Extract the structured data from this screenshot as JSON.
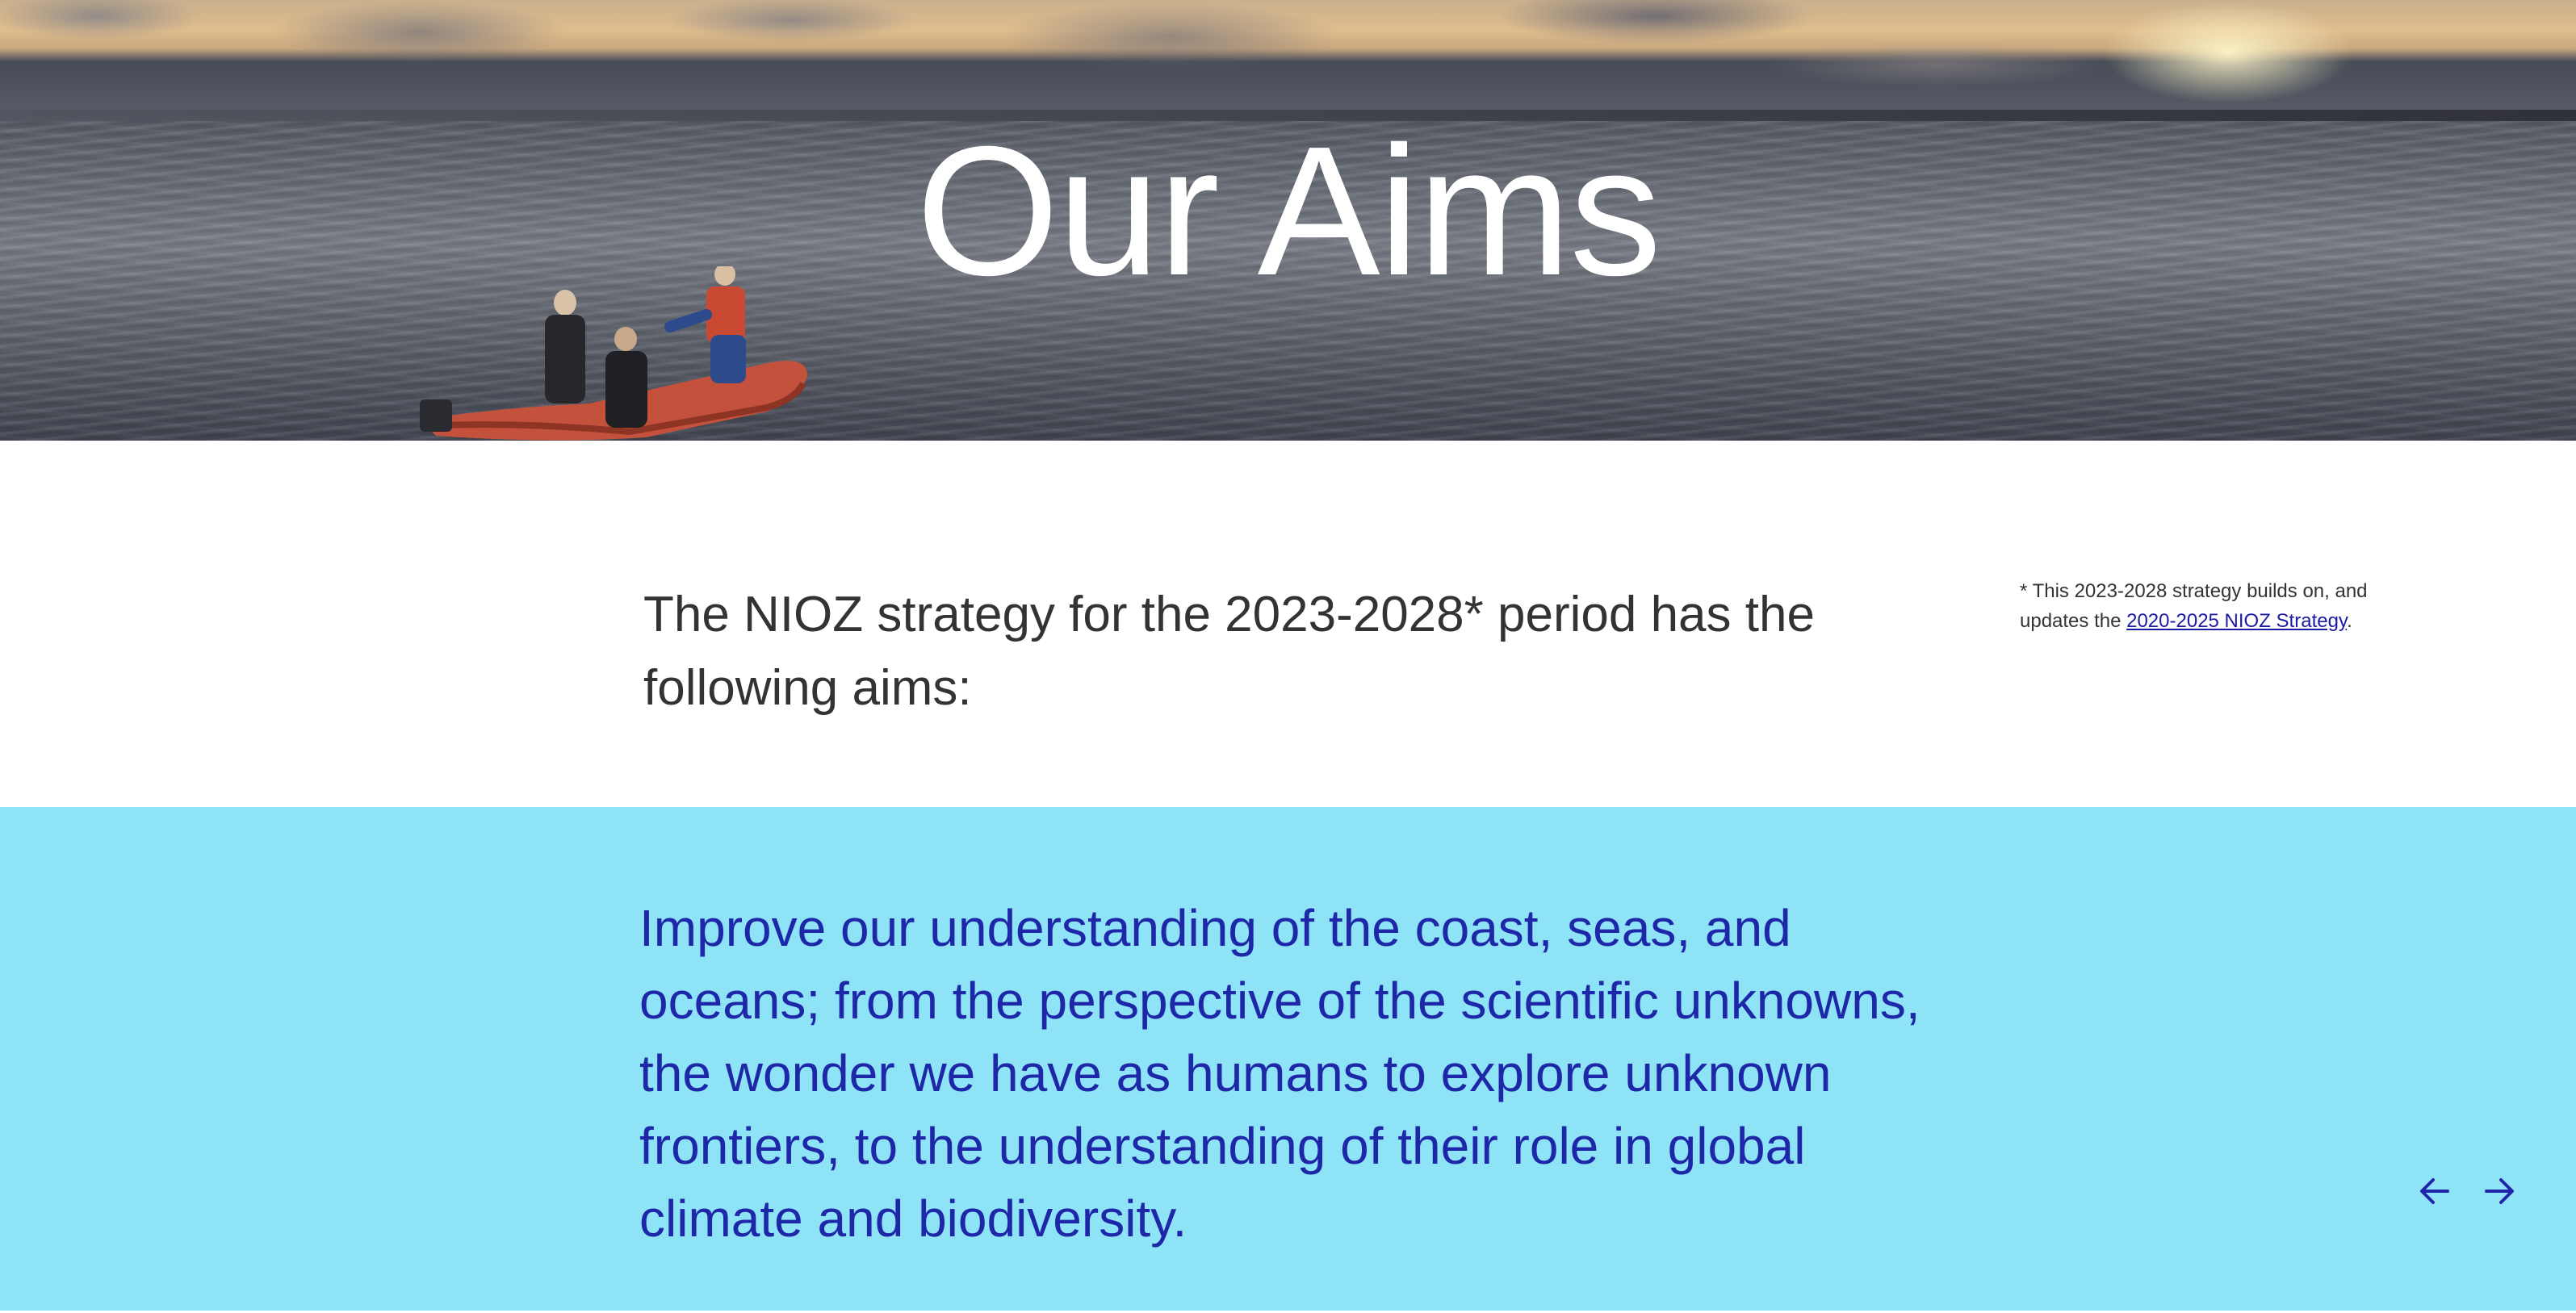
{
  "hero": {
    "title": "Our Aims",
    "image_icon": "boat-at-sea-image"
  },
  "intro": {
    "text": "The NIOZ strategy for the 2023-2028* period has the following aims:",
    "footnote_prefix": "* This 2023-2028 strategy builds on, and updates the ",
    "footnote_link_label": "2020-2025 NIOZ Strategy",
    "footnote_suffix": "."
  },
  "aims": {
    "current_aim": "Improve our understanding of the coast, seas, and oceans; from the perspective of the scientific unknowns, the wonder we have as humans to explore unknown frontiers, to the understanding of their role in global climate and biodiversity.",
    "prev_icon": "arrow-left-icon",
    "next_icon": "arrow-right-icon"
  },
  "colors": {
    "aims_background": "#8ee3f6",
    "aims_text": "#1d27a8",
    "body_text": "#333333",
    "link": "#1a1aa6"
  }
}
